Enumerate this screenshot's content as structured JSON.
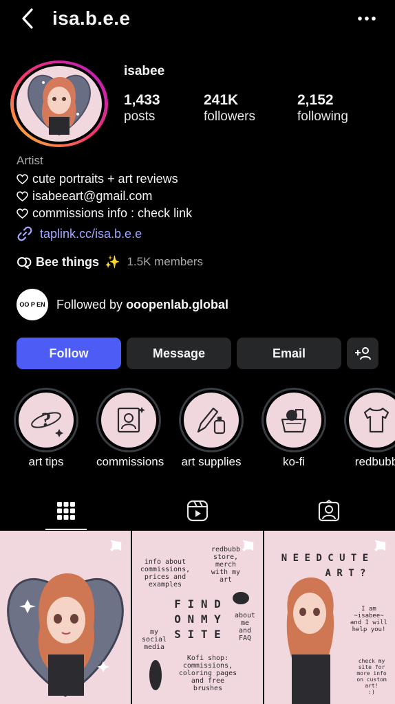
{
  "header": {
    "handle": "isa.b.e.e",
    "back_icon": "chevron-left-icon",
    "more_icon": "more-horizontal-icon"
  },
  "profile": {
    "display_name": "isabee",
    "stats": [
      {
        "value": "1,433",
        "label": "posts"
      },
      {
        "value": "241K",
        "label": "followers"
      },
      {
        "value": "2,152",
        "label": "following"
      }
    ],
    "category": "Artist",
    "bio_lines": [
      "cute portraits + art reviews",
      "isabeeart@gmail.com",
      "commissions info : check link"
    ],
    "link": "taplink.cc/isa.b.e.e"
  },
  "channel": {
    "name": "Bee things",
    "emoji": "✨",
    "members": "1.5K members"
  },
  "followed_by": {
    "prefix": "Followed by ",
    "account": "ooopenlab.global",
    "badge_text": "OO P EN"
  },
  "actions": {
    "follow": "Follow",
    "message": "Message",
    "email": "Email",
    "add_user_glyph": "+"
  },
  "highlights": [
    {
      "label": "art tips",
      "icon": "planet-question-icon"
    },
    {
      "label": "commissions",
      "icon": "portrait-frame-icon"
    },
    {
      "label": "art supplies",
      "icon": "pencil-bottle-icon"
    },
    {
      "label": "ko-fi",
      "icon": "coffee-basket-icon"
    },
    {
      "label": "redbubb",
      "icon": "tshirt-icon"
    }
  ],
  "tabs": [
    {
      "name": "posts",
      "icon": "grid-icon",
      "active": true
    },
    {
      "name": "reels",
      "icon": "reels-icon",
      "active": false
    },
    {
      "name": "tagged",
      "icon": "tagged-user-icon",
      "active": false
    }
  ],
  "posts": [
    {
      "pinned": true
    },
    {
      "pinned": true,
      "texts": [
        "info about",
        "commissions,",
        "prices and",
        "examples",
        "redbubb",
        "store,",
        "merch",
        "with my",
        "art",
        "F I N D",
        "O N  M Y",
        "S I T E",
        "my",
        "social",
        "media",
        "about",
        "me",
        "and",
        "FAQ",
        "Kofi shop:",
        "commissions,",
        "coloring pages",
        "and free",
        "brushes"
      ]
    },
    {
      "pinned": true,
      "texts": [
        "N E E D  C U T E",
        "A R T ?",
        "I am",
        "~isabee~",
        "and I will",
        "help you!",
        "check my",
        "site for",
        "more info",
        "on custom",
        "art!",
        ":)"
      ]
    }
  ],
  "colors": {
    "accent": "#4c5cf5",
    "link": "#a3a7ff",
    "tile_bg": "#f1d7de",
    "button_bg": "#262729"
  }
}
